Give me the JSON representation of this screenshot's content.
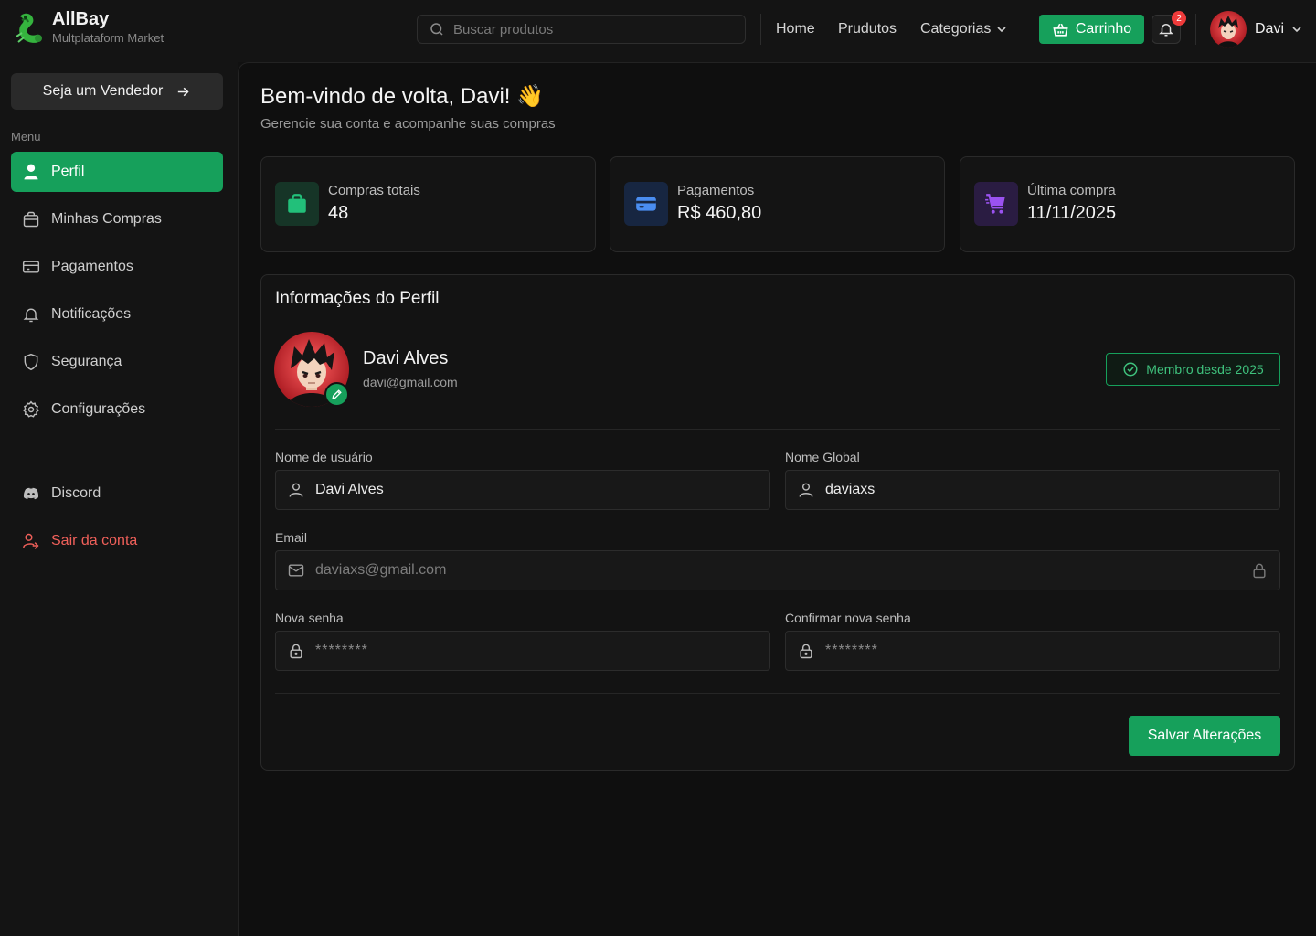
{
  "brand": {
    "name": "AllBay",
    "subtitle": "Multplataform Market"
  },
  "header": {
    "search_placeholder": "Buscar produtos",
    "nav": {
      "home": "Home",
      "products": "Prudutos",
      "categories": "Categorias"
    },
    "cart_label": "Carrinho",
    "notification_count": "2",
    "user_name": "Davi"
  },
  "sidebar": {
    "seller_button": "Seja um Vendedor",
    "menu_title": "Menu",
    "items": [
      {
        "label": "Perfil",
        "icon": "user-icon",
        "active": true
      },
      {
        "label": "Minhas Compras",
        "icon": "shopping-bag-icon"
      },
      {
        "label": "Pagamentos",
        "icon": "credit-card-icon"
      },
      {
        "label": "Notificações",
        "icon": "bell-icon"
      },
      {
        "label": "Segurança",
        "icon": "shield-icon"
      },
      {
        "label": "Configurações",
        "icon": "gear-icon"
      }
    ],
    "discord": "Discord",
    "logout": "Sair da conta"
  },
  "main": {
    "welcome": "Bem-vindo de volta, Davi! 👋",
    "subtitle": "Gerencie sua conta e acompanhe suas compras",
    "stats": [
      {
        "label": "Compras totais",
        "value": "48",
        "icon": "shopping-bag-icon",
        "color": "#22c07a"
      },
      {
        "label": "Pagamentos",
        "value": "R$ 460,80",
        "icon": "credit-card-icon",
        "color": "#4a8df0"
      },
      {
        "label": "Última compra",
        "value": "11/11/2025",
        "icon": "cart-icon",
        "color": "#9a52f0"
      }
    ],
    "profile": {
      "title": "Informações do Perfil",
      "name": "Davi Alves",
      "email": "davi@gmail.com",
      "member_badge": "Membro desde 2025",
      "fields": {
        "username_label": "Nome de usuário",
        "username_value": "Davi Alves",
        "global_label": "Nome Global",
        "global_value": "daviaxs",
        "email_label": "Email",
        "email_value": "daviaxs@gmail.com",
        "new_password_label": "Nova senha",
        "new_password_placeholder": "********",
        "confirm_password_label": "Confirmar nova senha",
        "confirm_password_placeholder": "********"
      },
      "save_button": "Salvar Alterações"
    }
  },
  "colors": {
    "accent": "#16a05b",
    "danger": "#f0605a",
    "badge": "#ef3b3b"
  }
}
